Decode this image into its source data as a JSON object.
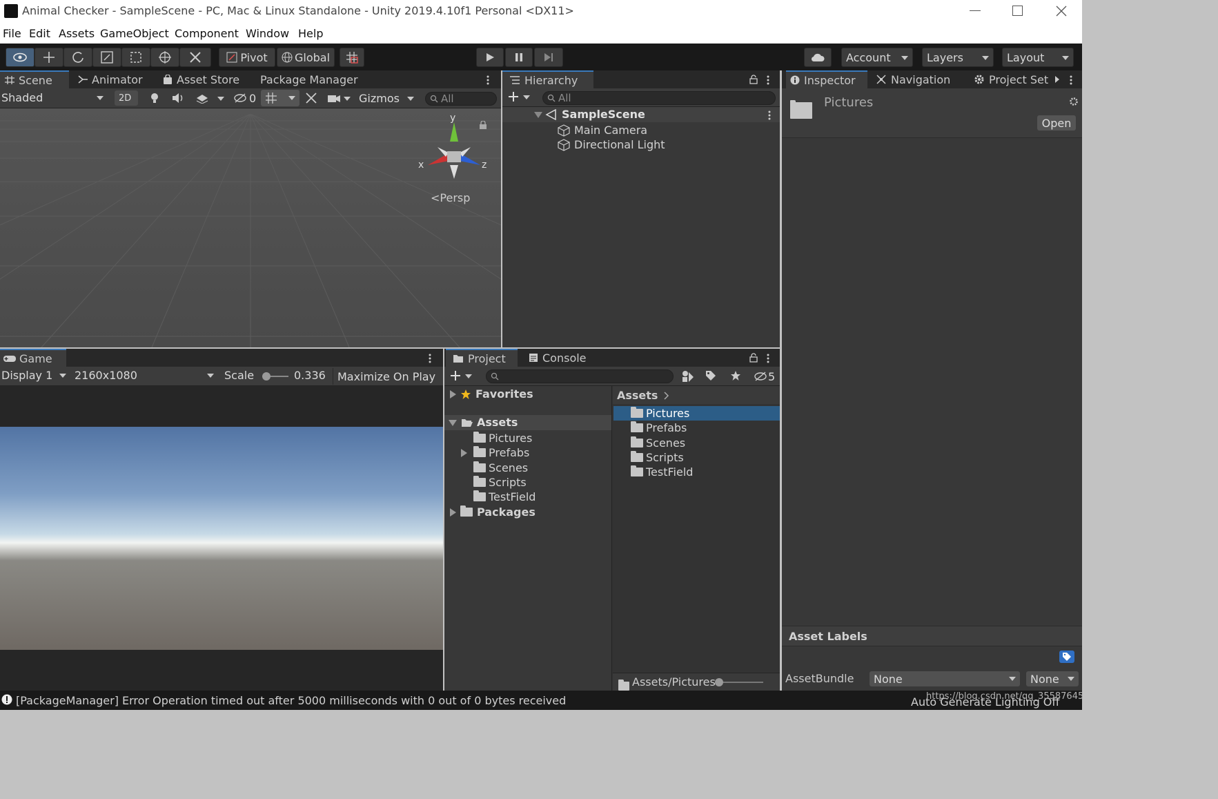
{
  "window": {
    "title": "Animal Checker - SampleScene - PC, Mac & Linux Standalone - Unity 2019.4.10f1 Personal <DX11>"
  },
  "menu": [
    "File",
    "Edit",
    "Assets",
    "GameObject",
    "Component",
    "Window",
    "Help"
  ],
  "toolbar": {
    "pivot": "Pivot",
    "global": "Global",
    "account": "Account",
    "layers": "Layers",
    "layout": "Layout"
  },
  "scene_panel": {
    "tabs": [
      "Scene",
      "Animator",
      "Asset Store",
      "Package Manager"
    ],
    "shading": "Shaded",
    "mode_2d": "2D",
    "hidden_count": "0",
    "gizmos": "Gizmos",
    "search_placeholder": "All",
    "gizmo": {
      "y": "y",
      "x": "x",
      "z": "z",
      "persp": "Persp"
    }
  },
  "hierarchy": {
    "tab": "Hierarchy",
    "search_placeholder": "All",
    "scene": "SampleScene",
    "items": [
      "Main Camera",
      "Directional Light"
    ]
  },
  "inspector": {
    "tabs": [
      "Inspector",
      "Navigation",
      "Project Set"
    ],
    "asset_name": "Pictures",
    "open_label": "Open",
    "labels_title": "Asset Labels",
    "assetbundle_label": "AssetBundle",
    "assetbundle_value": "None",
    "variant_value": "None"
  },
  "game_panel": {
    "tab": "Game",
    "display": "Display 1",
    "resolution": "2160x1080",
    "scale_label": "Scale",
    "scale_value": "0.336",
    "maximize": "Maximize On Play"
  },
  "project": {
    "tabs": [
      "Project",
      "Console"
    ],
    "hidden_count": "5",
    "favorites": "Favorites",
    "assets": "Assets",
    "packages": "Packages",
    "tree": [
      "Pictures",
      "Prefabs",
      "Scenes",
      "Scripts",
      "TestField"
    ],
    "breadcrumb": "Assets",
    "grid": [
      "Pictures",
      "Prefabs",
      "Scenes",
      "Scripts",
      "TestField"
    ],
    "path": "Assets/Pictures"
  },
  "status": {
    "message": "[PackageManager] Error Operation timed out after 5000 milliseconds with 0 out of 0 bytes received",
    "right": "Auto Generate Lighting Off",
    "watermark": "https://blog.csdn.net/qq_35587645"
  }
}
